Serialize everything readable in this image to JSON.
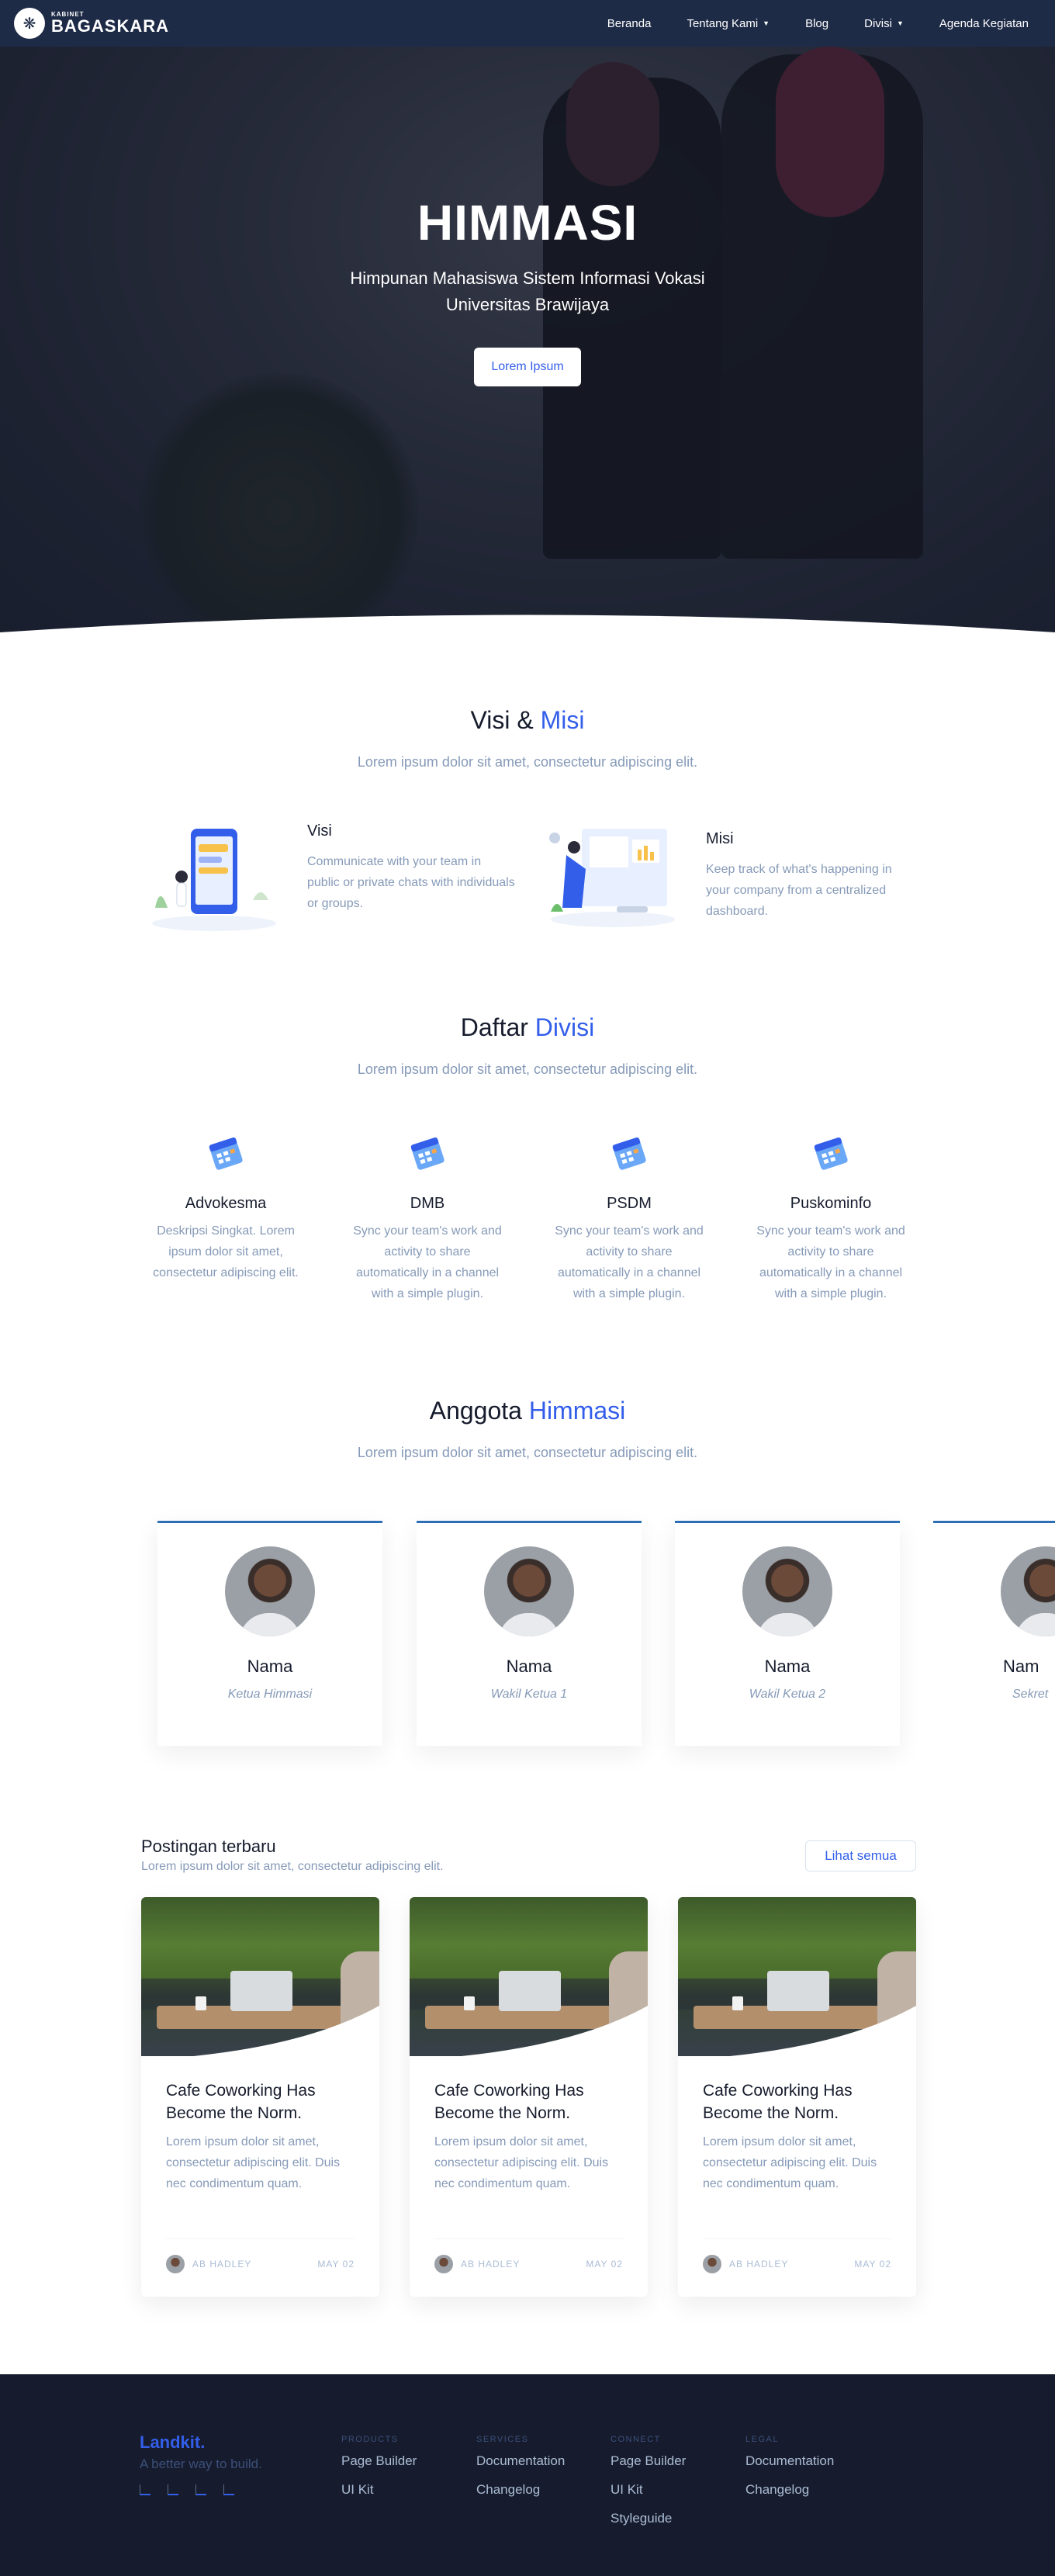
{
  "nav": {
    "brand_small": "KABINET",
    "brand_name": "BAGASKARA",
    "links": [
      {
        "label": "Beranda"
      },
      {
        "label": "Tentang Kami"
      },
      {
        "label": "Blog"
      },
      {
        "label": "Divisi"
      },
      {
        "label": "Agenda Kegiatan"
      }
    ]
  },
  "hero": {
    "title": "HIMMASI",
    "subtitle_line1": "Himpunan Mahasiswa Sistem Informasi Vokasi",
    "subtitle_line2": "Universitas Brawijaya",
    "button": "Lorem Ipsum"
  },
  "visi_misi": {
    "title_plain": "Visi &",
    "title_accent": "Misi",
    "subtitle": "Lorem ipsum dolor sit amet, consectetur adipiscing elit.",
    "items": [
      {
        "title": "Visi",
        "text": "Communicate with your team in public or private chats with individuals or groups."
      },
      {
        "title": "Misi",
        "text": "Keep track of what's happening in your company from a centralized dashboard."
      }
    ]
  },
  "divisi": {
    "title_plain": "Daftar",
    "title_accent": "Divisi",
    "subtitle": "Lorem ipsum dolor sit amet, consectetur adipiscing elit.",
    "items": [
      {
        "name": "Advokesma",
        "desc": "Deskripsi Singkat. Lorem ipsum dolor sit amet, consectetur adipiscing elit."
      },
      {
        "name": "DMB",
        "desc": "Sync your team's work and activity to share automatically in a channel with a simple plugin."
      },
      {
        "name": "PSDM",
        "desc": "Sync your team's work and activity to share automatically in a channel with a simple plugin."
      },
      {
        "name": "Puskominfo",
        "desc": "Sync your team's work and activity to share automatically in a channel with a simple plugin."
      }
    ]
  },
  "anggota": {
    "title_plain": "Anggota",
    "title_accent": "Himmasi",
    "subtitle": "Lorem ipsum dolor sit amet, consectetur adipiscing elit.",
    "members": [
      {
        "name": "Nama",
        "role": "Ketua Himmasi"
      },
      {
        "name": "Nama",
        "role": "Wakil Ketua 1"
      },
      {
        "name": "Nama",
        "role": "Wakil Ketua 2"
      },
      {
        "name": "Nam",
        "role": "Sekret"
      }
    ]
  },
  "posts": {
    "title": "Postingan terbaru",
    "subtitle": "Lorem ipsum dolor sit amet, consectetur adipiscing elit.",
    "button": "Lihat semua",
    "items": [
      {
        "title": "Cafe Coworking Has Become the Norm.",
        "desc": "Lorem ipsum dolor sit amet, consectetur adipiscing elit. Duis nec condimentum quam.",
        "author": "AB HADLEY",
        "date": "MAY 02"
      },
      {
        "title": "Cafe Coworking Has Become the Norm.",
        "desc": "Lorem ipsum dolor sit amet, consectetur adipiscing elit. Duis nec condimentum quam.",
        "author": "AB HADLEY",
        "date": "MAY 02"
      },
      {
        "title": "Cafe Coworking Has Become the Norm.",
        "desc": "Lorem ipsum dolor sit amet, consectetur adipiscing elit. Duis nec condimentum quam.",
        "author": "AB HADLEY",
        "date": "MAY 02"
      }
    ]
  },
  "footer": {
    "brand": "Landkit.",
    "tagline": "A better way to build.",
    "columns": [
      {
        "heading": "PRODUCTS",
        "links": [
          "Page Builder",
          "UI Kit"
        ]
      },
      {
        "heading": "SERVICES",
        "links": [
          "Documentation",
          "Changelog"
        ]
      },
      {
        "heading": "CONNECT",
        "links": [
          "Page Builder",
          "UI Kit",
          "Styleguide"
        ]
      },
      {
        "heading": "LEGAL",
        "links": [
          "Documentation",
          "Changelog"
        ]
      }
    ]
  },
  "colors": {
    "accent": "#335eea",
    "nav_bg": "#1e2b47",
    "footer_bg": "#161c2d",
    "muted_text": "#869ab8",
    "member_border": "#2c6fb7"
  }
}
